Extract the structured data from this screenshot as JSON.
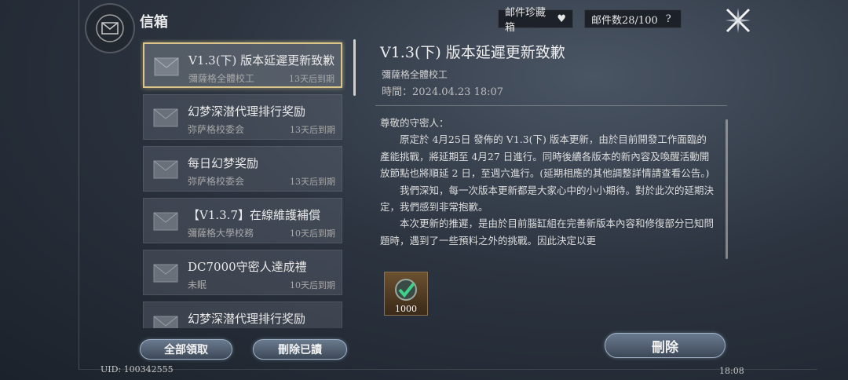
{
  "header": {
    "title": "信箱",
    "collection_label": "邮件珍藏箱",
    "count_label": "邮件数28/100",
    "help_label": "?"
  },
  "mails": [
    {
      "title": "V1.3(下) 版本延遲更新致歉",
      "sender": "彌薩格全體校工",
      "expire": "13天后到期",
      "selected": true
    },
    {
      "title": "幻梦深潜代理排行奖励",
      "sender": "弥萨格校委会",
      "expire": "13天后到期"
    },
    {
      "title": "每日幻梦奖励",
      "sender": "弥萨格校委会",
      "expire": "13天后到期"
    },
    {
      "title": "【V1.3.7】在線維護補償",
      "sender": "彌薩格大學校務",
      "expire": "10天后到期"
    },
    {
      "title": "DC7000守密人達成禮",
      "sender": "未眠",
      "expire": "10天后到期"
    },
    {
      "title": "幻梦深潜代理排行奖励",
      "sender": "",
      "expire": ""
    }
  ],
  "detail": {
    "title": "V1.3(下) 版本延遲更新致歉",
    "sender": "彌薩格全體校工",
    "time": "時間：2024.04.23 18:07",
    "body": [
      "尊敬的守密人：",
      "原定於 4月25日 發佈的 V1.3(下) 版本更新，由於目前開發工作面臨的產能挑戰，將延期至 4月27 日進行。同時後續各版本的新內容及喚醒活動開放節點也將順延 2 日，至週六進行。(延期相應的其他調整詳情請查看公告。)",
      "我們深知，每一次版本更新都是大家心中的小小期待。對於此次的延期決定，我們感到非常抱歉。",
      "本次更新的推遲，是由於目前腦缸組在完善新版本內容和修復部分已知問題時，遇到了一些預料之外的挑戰。因此決定以更"
    ],
    "attachment_count": "1000"
  },
  "buttons": {
    "claim_all": "全部領取",
    "delete_read": "刪除已讀",
    "delete": "刪除"
  },
  "footer": {
    "uid": "UID: 100342555",
    "clock": "18:08"
  }
}
